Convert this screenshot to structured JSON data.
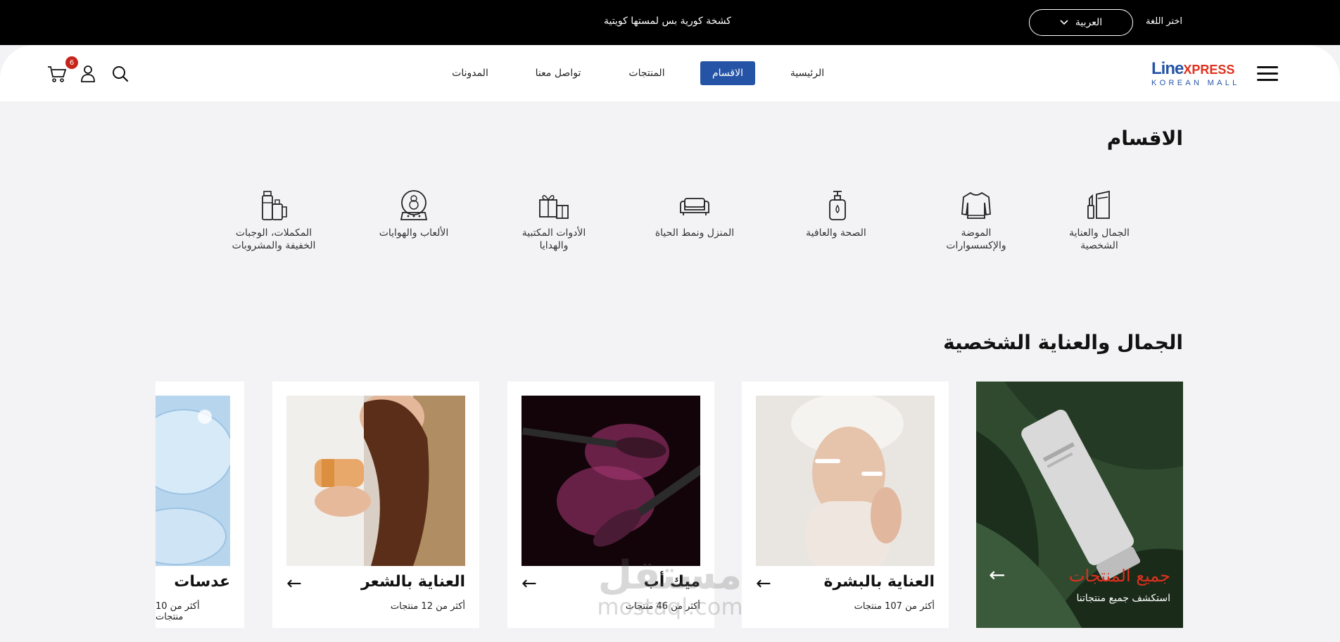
{
  "topbar": {
    "promo": "كشخة كورية بس لمستها كويتية",
    "language_value": "العربية",
    "language_label": "اختر اللغة"
  },
  "header": {
    "logo_main": "Line",
    "logo_accent": "XPRESS",
    "logo_sub": "KOREAN MALL",
    "cart_count": "6",
    "nav": [
      {
        "label": "الرئيسية"
      },
      {
        "label": "الاقسام"
      },
      {
        "label": "المنتجات"
      },
      {
        "label": "تواصل معنا"
      },
      {
        "label": "المدونات"
      }
    ],
    "active_nav": "الاقسام",
    "accent_color": "#2554a6"
  },
  "categories": {
    "title": "الاقسام",
    "items": [
      {
        "label": "الجمال والعناية الشخصية",
        "icon": "cosmetics-icon"
      },
      {
        "label": "الموضة والإكسسوارات",
        "icon": "sweater-icon"
      },
      {
        "label": "الصحة والعافية",
        "icon": "pump-bottle-icon"
      },
      {
        "label": "المنزل ونمط الحياة",
        "icon": "sofa-icon"
      },
      {
        "label": "الأدوات المكتبية والهدايا",
        "icon": "gift-icon"
      },
      {
        "label": "الألعاب والهوايات",
        "icon": "snow-globe-icon"
      },
      {
        "label": "المكملات، الوجبات الخفيفة والمشروبات",
        "icon": "supplements-icon"
      }
    ]
  },
  "beauty": {
    "title": "الجمال والعناية الشخصية",
    "featured": {
      "title": "جميع المنتجات",
      "subtitle": "استكشف جميع منتجاتنا"
    },
    "cards": [
      {
        "title": "العناية بالبشرة",
        "count": "أكثر من 107 منتجات"
      },
      {
        "title": "ميك أب",
        "count": "أكثر من 46 منتجات"
      },
      {
        "title": "العناية بالشعر",
        "count": "أكثر من 12 منتجات"
      },
      {
        "title": "عدسات",
        "count": "أكثر من 10 منتجات"
      }
    ]
  },
  "watermark": {
    "line1": "مستقل",
    "line2": "mostaql.com"
  }
}
